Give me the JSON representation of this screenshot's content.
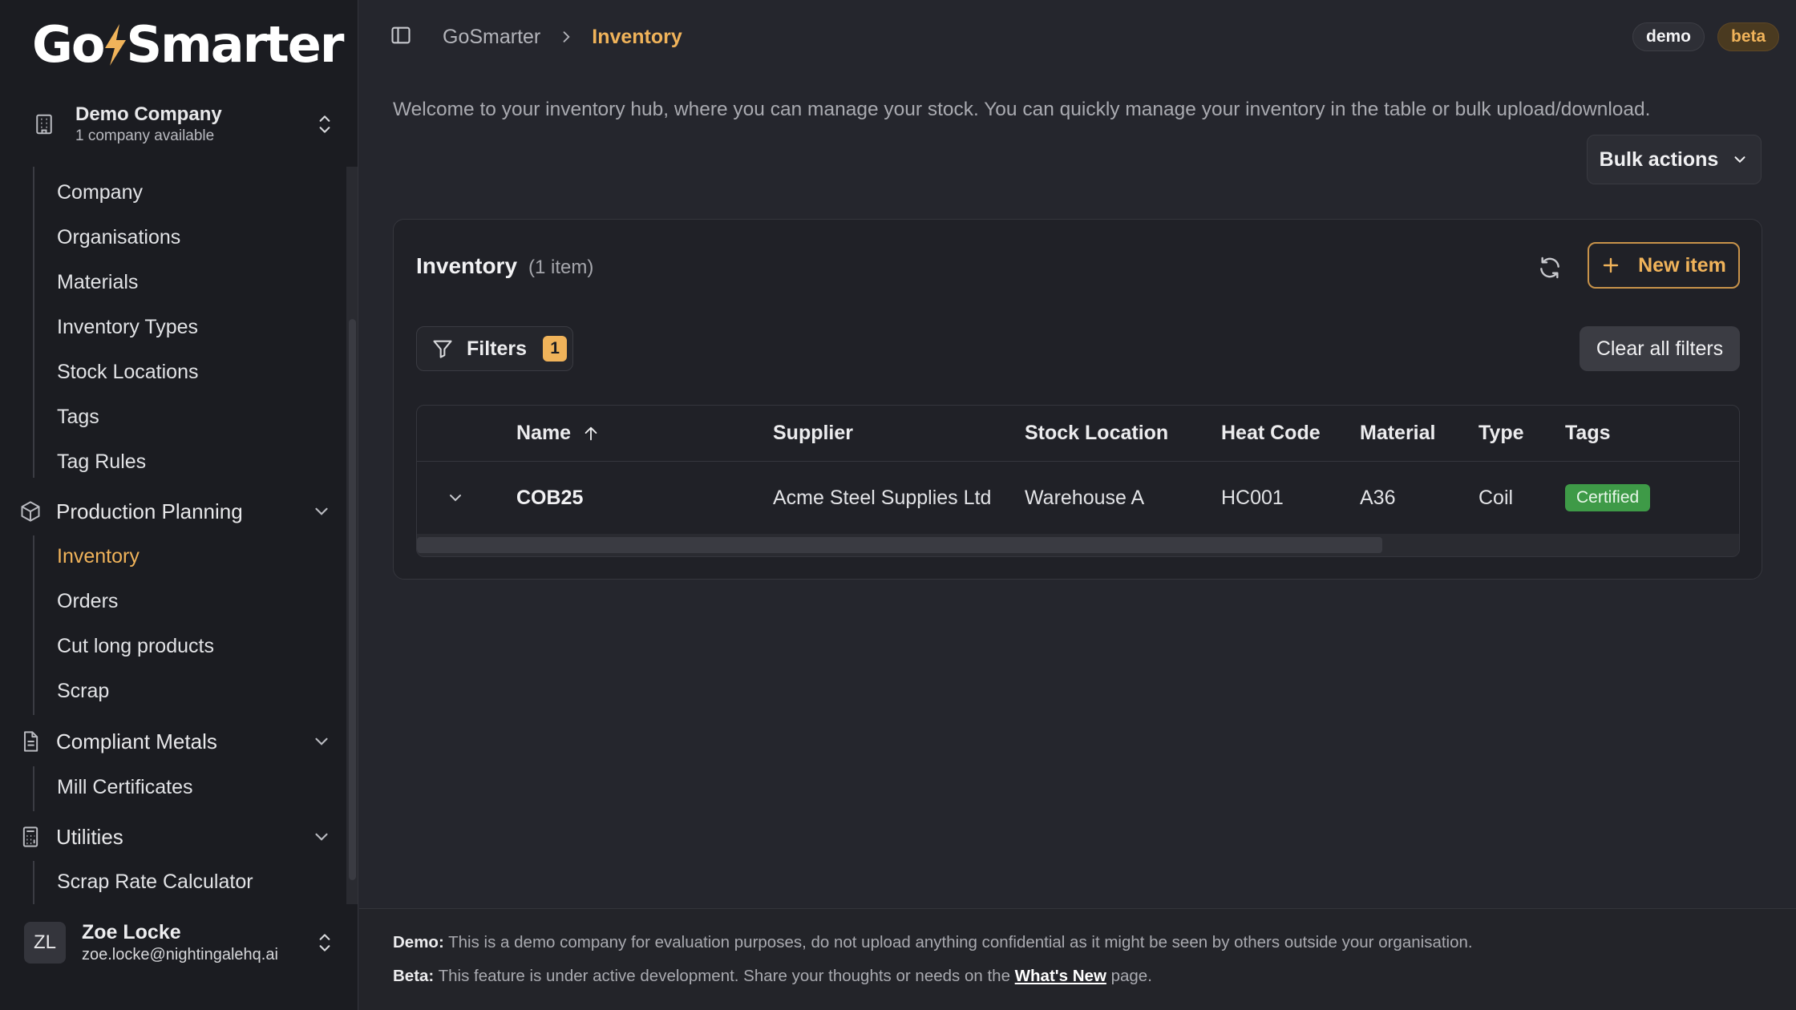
{
  "brand": {
    "name_left": "Go",
    "name_right": "Smarter",
    "accent_color": "#f0b35a"
  },
  "company": {
    "name": "Demo Company",
    "sub": "1 company available",
    "icon": "building-icon"
  },
  "nav": {
    "company_items": [
      {
        "label": "Company"
      },
      {
        "label": "Organisations"
      },
      {
        "label": "Materials"
      },
      {
        "label": "Inventory Types"
      },
      {
        "label": "Stock Locations"
      },
      {
        "label": "Tags"
      },
      {
        "label": "Tag Rules"
      }
    ],
    "production": {
      "label": "Production Planning",
      "icon": "package-icon",
      "items": [
        {
          "label": "Inventory",
          "active": true
        },
        {
          "label": "Orders"
        },
        {
          "label": "Cut long products"
        },
        {
          "label": "Scrap"
        }
      ]
    },
    "compliant": {
      "label": "Compliant Metals",
      "icon": "document-icon",
      "items": [
        {
          "label": "Mill Certificates"
        }
      ]
    },
    "utilities": {
      "label": "Utilities",
      "icon": "calculator-icon",
      "items": [
        {
          "label": "Scrap Rate Calculator"
        }
      ]
    }
  },
  "user": {
    "initials": "ZL",
    "name": "Zoe Locke",
    "email": "zoe.locke@nightingalehq.ai"
  },
  "topbar": {
    "breadcrumb_home": "GoSmarter",
    "breadcrumb_current": "Inventory",
    "badge_demo": "demo",
    "badge_beta": "beta"
  },
  "page": {
    "intro": "Welcome to your inventory hub, where you can manage your stock. You can quickly manage your inventory in the table or bulk upload/download.",
    "bulk_actions": "Bulk actions"
  },
  "card": {
    "title": "Inventory",
    "count": "(1 item)",
    "new_item": "New item",
    "filters_label": "Filters",
    "filters_count": "1",
    "clear_filters": "Clear all filters"
  },
  "table": {
    "columns": [
      "Name",
      "Supplier",
      "Stock Location",
      "Heat Code",
      "Material",
      "Type",
      "Tags"
    ],
    "rows": [
      {
        "name": "COB25",
        "supplier": "Acme Steel Supplies Ltd",
        "stock_location": "Warehouse A",
        "heat_code": "HC001",
        "material": "A36",
        "type": "Coil",
        "tag": "Certified"
      }
    ]
  },
  "footer": {
    "demo_label": "Demo:",
    "demo_text": " This is a demo company for evaluation purposes, do not upload anything confidential as it might be seen by others outside your organisation.",
    "beta_label": "Beta:",
    "beta_text": " This feature is under active development. Share your thoughts or needs on the ",
    "beta_link": "What's New",
    "beta_tail": " page."
  }
}
